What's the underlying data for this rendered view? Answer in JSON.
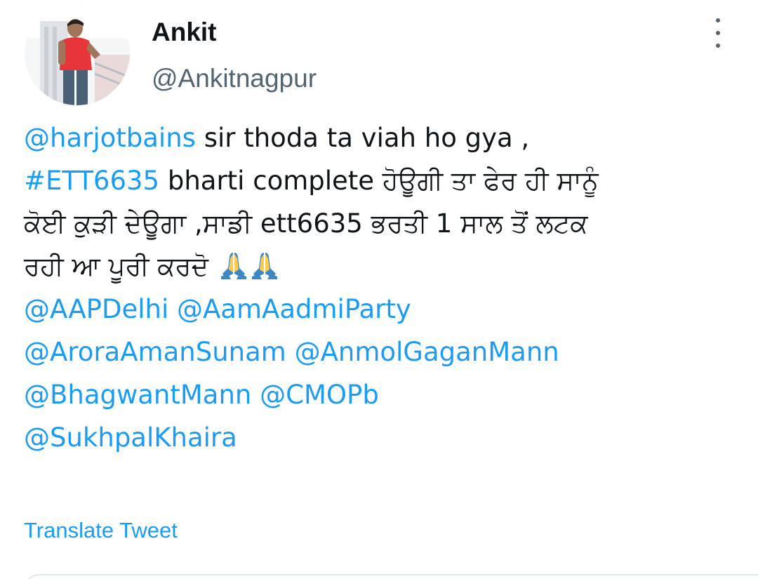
{
  "author": {
    "display_name": "Ankit",
    "handle": "@Ankitnagpur"
  },
  "tweet": {
    "line1": {
      "mention": "@harjotbains",
      "text": " sir thoda ta viah ho gya ,"
    },
    "line2": {
      "hashtag": "#ETT6635",
      "text": " bharti complete ਹੋਊਗੀ ਤਾ ਫੇਰ ਹੀ ਸਾਨੂੰ"
    },
    "line3": {
      "text": "ਕੋਈ ਕੁੜੀ ਦੇਊਗਾ ,ਸਾਡੀ ett6635 ਭਰਤੀ 1 ਸਾਲ ਤੋਂ ਲਟਕ"
    },
    "line4": {
      "text": "ਰਹੀ ਆ ਪੂਰੀ ਕਰਦੋ ",
      "emoji": [
        "folded-hands",
        "folded-hands"
      ]
    },
    "mentions_line5": [
      "@AAPDelhi",
      "@AamAadmiParty"
    ],
    "mentions_line6": [
      "@AroraAmanSunam",
      "@AnmolGaganMann"
    ],
    "mentions_line7": [
      "@BhagwantMann",
      "@CMOPb"
    ],
    "mentions_line8": [
      "@SukhpalKhaira"
    ]
  },
  "translate_label": "Translate Tweet",
  "colors": {
    "link": "#1d9bf0",
    "text": "#0f1419",
    "secondary": "#536471"
  }
}
